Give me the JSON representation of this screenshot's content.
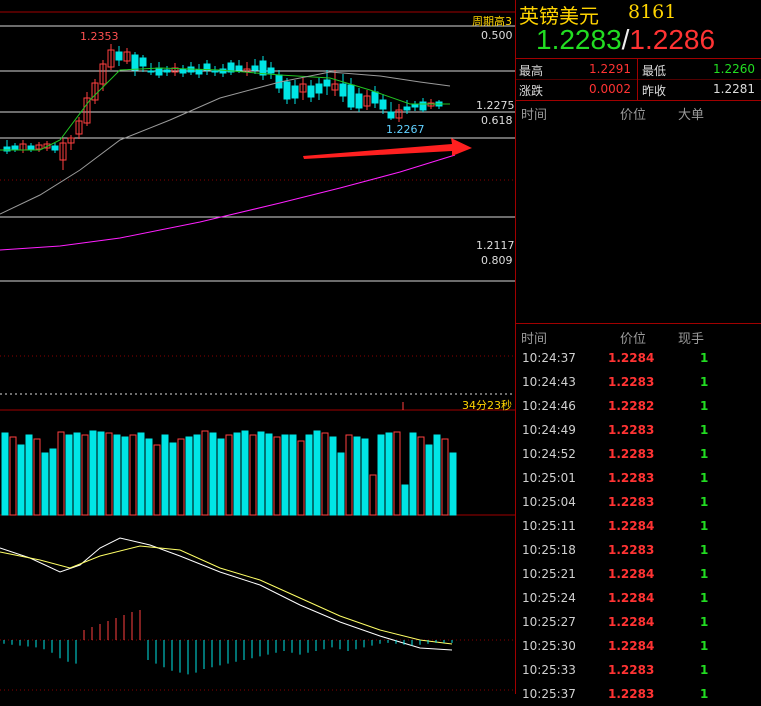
{
  "chart": {
    "fib_labels": {
      "period_high": "周期高3",
      "fib_500": "0.500",
      "price_high": "1.2353",
      "price_current": "1.2275",
      "fib_618": "0.618",
      "price_low_mark": "1.2267",
      "price_1_2117": "1.2117",
      "fib_809": "0.809"
    },
    "countdown": "34分23秒",
    "colors": {
      "up_candle": "#ff4040",
      "down_candle": "#00e5e5",
      "ma_short": "#22c422",
      "ma_mid": "#9a9a9a",
      "ma_long": "#ff20ff",
      "fib_line": "#ffffff",
      "arrow": "#ff2020"
    }
  },
  "quote": {
    "name": "英镑美元",
    "code": "8161",
    "bid": "1.2283",
    "separator": "/",
    "ask": "1.2286",
    "high_label": "最高",
    "high_value": "1.2291",
    "low_label": "最低",
    "low_value": "1.2260",
    "change_label": "涨跌",
    "change_value": "0.0002",
    "prev_close_label": "昨收",
    "prev_close_value": "1.2281",
    "big_orders": {
      "col_time": "时间",
      "col_price": "价位",
      "col_size": "大单"
    },
    "ticks": {
      "col_time": "时间",
      "col_price": "价位",
      "col_volume": "现手",
      "rows": [
        {
          "time": "10:24:37",
          "price": "1.2284",
          "volume": "1"
        },
        {
          "time": "10:24:43",
          "price": "1.2283",
          "volume": "1"
        },
        {
          "time": "10:24:46",
          "price": "1.2282",
          "volume": "1"
        },
        {
          "time": "10:24:49",
          "price": "1.2283",
          "volume": "1"
        },
        {
          "time": "10:24:52",
          "price": "1.2283",
          "volume": "1"
        },
        {
          "time": "10:25:01",
          "price": "1.2283",
          "volume": "1"
        },
        {
          "time": "10:25:04",
          "price": "1.2283",
          "volume": "1"
        },
        {
          "time": "10:25:11",
          "price": "1.2284",
          "volume": "1"
        },
        {
          "time": "10:25:18",
          "price": "1.2283",
          "volume": "1"
        },
        {
          "time": "10:25:21",
          "price": "1.2284",
          "volume": "1"
        },
        {
          "time": "10:25:24",
          "price": "1.2284",
          "volume": "1"
        },
        {
          "time": "10:25:27",
          "price": "1.2284",
          "volume": "1"
        },
        {
          "time": "10:25:30",
          "price": "1.2284",
          "volume": "1"
        },
        {
          "time": "10:25:33",
          "price": "1.2283",
          "volume": "1"
        },
        {
          "time": "10:25:37",
          "price": "1.2283",
          "volume": "1"
        }
      ]
    }
  }
}
